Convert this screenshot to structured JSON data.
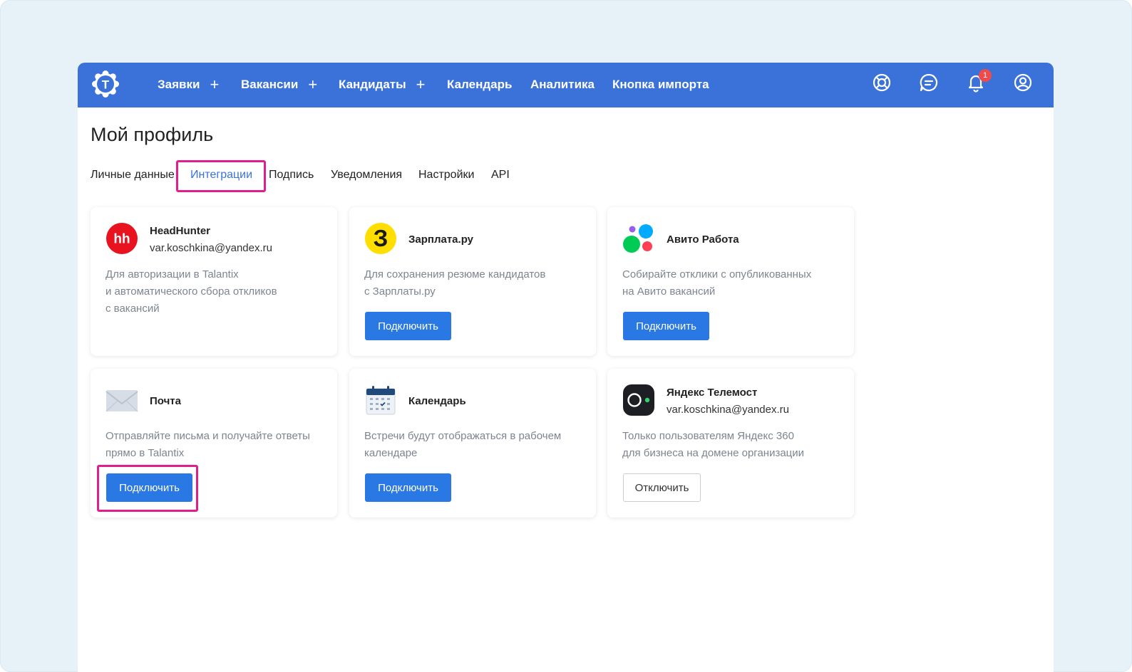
{
  "nav": {
    "items": [
      {
        "label": "Заявки",
        "plus": "+"
      },
      {
        "label": "Вакансии",
        "plus": "+"
      },
      {
        "label": "Кандидаты",
        "plus": "+"
      },
      {
        "label": "Календарь"
      },
      {
        "label": "Аналитика"
      },
      {
        "label": "Кнопка импорта"
      }
    ],
    "logo_letter": "T",
    "notifications_count": "1",
    "icons": [
      "lifebuoy-icon",
      "chat-icon",
      "bell-icon",
      "user-profile-icon"
    ]
  },
  "page": {
    "title": "Мой профиль",
    "tabs": [
      {
        "label": "Личные данные"
      },
      {
        "label": "Интеграции",
        "active": true
      },
      {
        "label": "Подпись"
      },
      {
        "label": "Уведомления"
      },
      {
        "label": "Настройки"
      },
      {
        "label": "API"
      }
    ]
  },
  "cards": [
    {
      "name": "HeadHunter",
      "sub": "var.koschkina@yandex.ru",
      "logo_text": "hh",
      "desc": [
        "Для авторизации в Talantix",
        "и автоматического сбора откликов",
        "с вакансий"
      ]
    },
    {
      "name": "Зарплата.ру",
      "logo_text": "З",
      "desc": [
        "Для сохранения резюме кандидатов",
        "с Зарплаты.ру"
      ],
      "button": "Подключить"
    },
    {
      "name": "Авито Работа",
      "desc": [
        "Собирайте отклики с опубликованных",
        "на Авито вакансий"
      ],
      "button": "Подключить"
    },
    {
      "name": "Почта",
      "desc": [
        "Отправляйте письма и получайте ответы",
        "прямо в Talantix"
      ],
      "button": "Подключить"
    },
    {
      "name": "Календарь",
      "desc": [
        "Встречи будут отображаться в рабочем",
        "календаре"
      ],
      "button": "Подключить"
    },
    {
      "name": "Яндекс Телемост",
      "sub": "var.koschkina@yandex.ru",
      "desc": [
        "Только пользователям Яндекс 360",
        "для бизнеса на домене организации"
      ],
      "button": "Отключить"
    }
  ],
  "colors": {
    "topbar": "#3a72d9",
    "primary_button": "#2a78e4",
    "highlight": "#e01e8c",
    "hh_red": "#e8131e",
    "zarplata_yellow": "#ffde00",
    "badge_red": "#f04b4b"
  }
}
